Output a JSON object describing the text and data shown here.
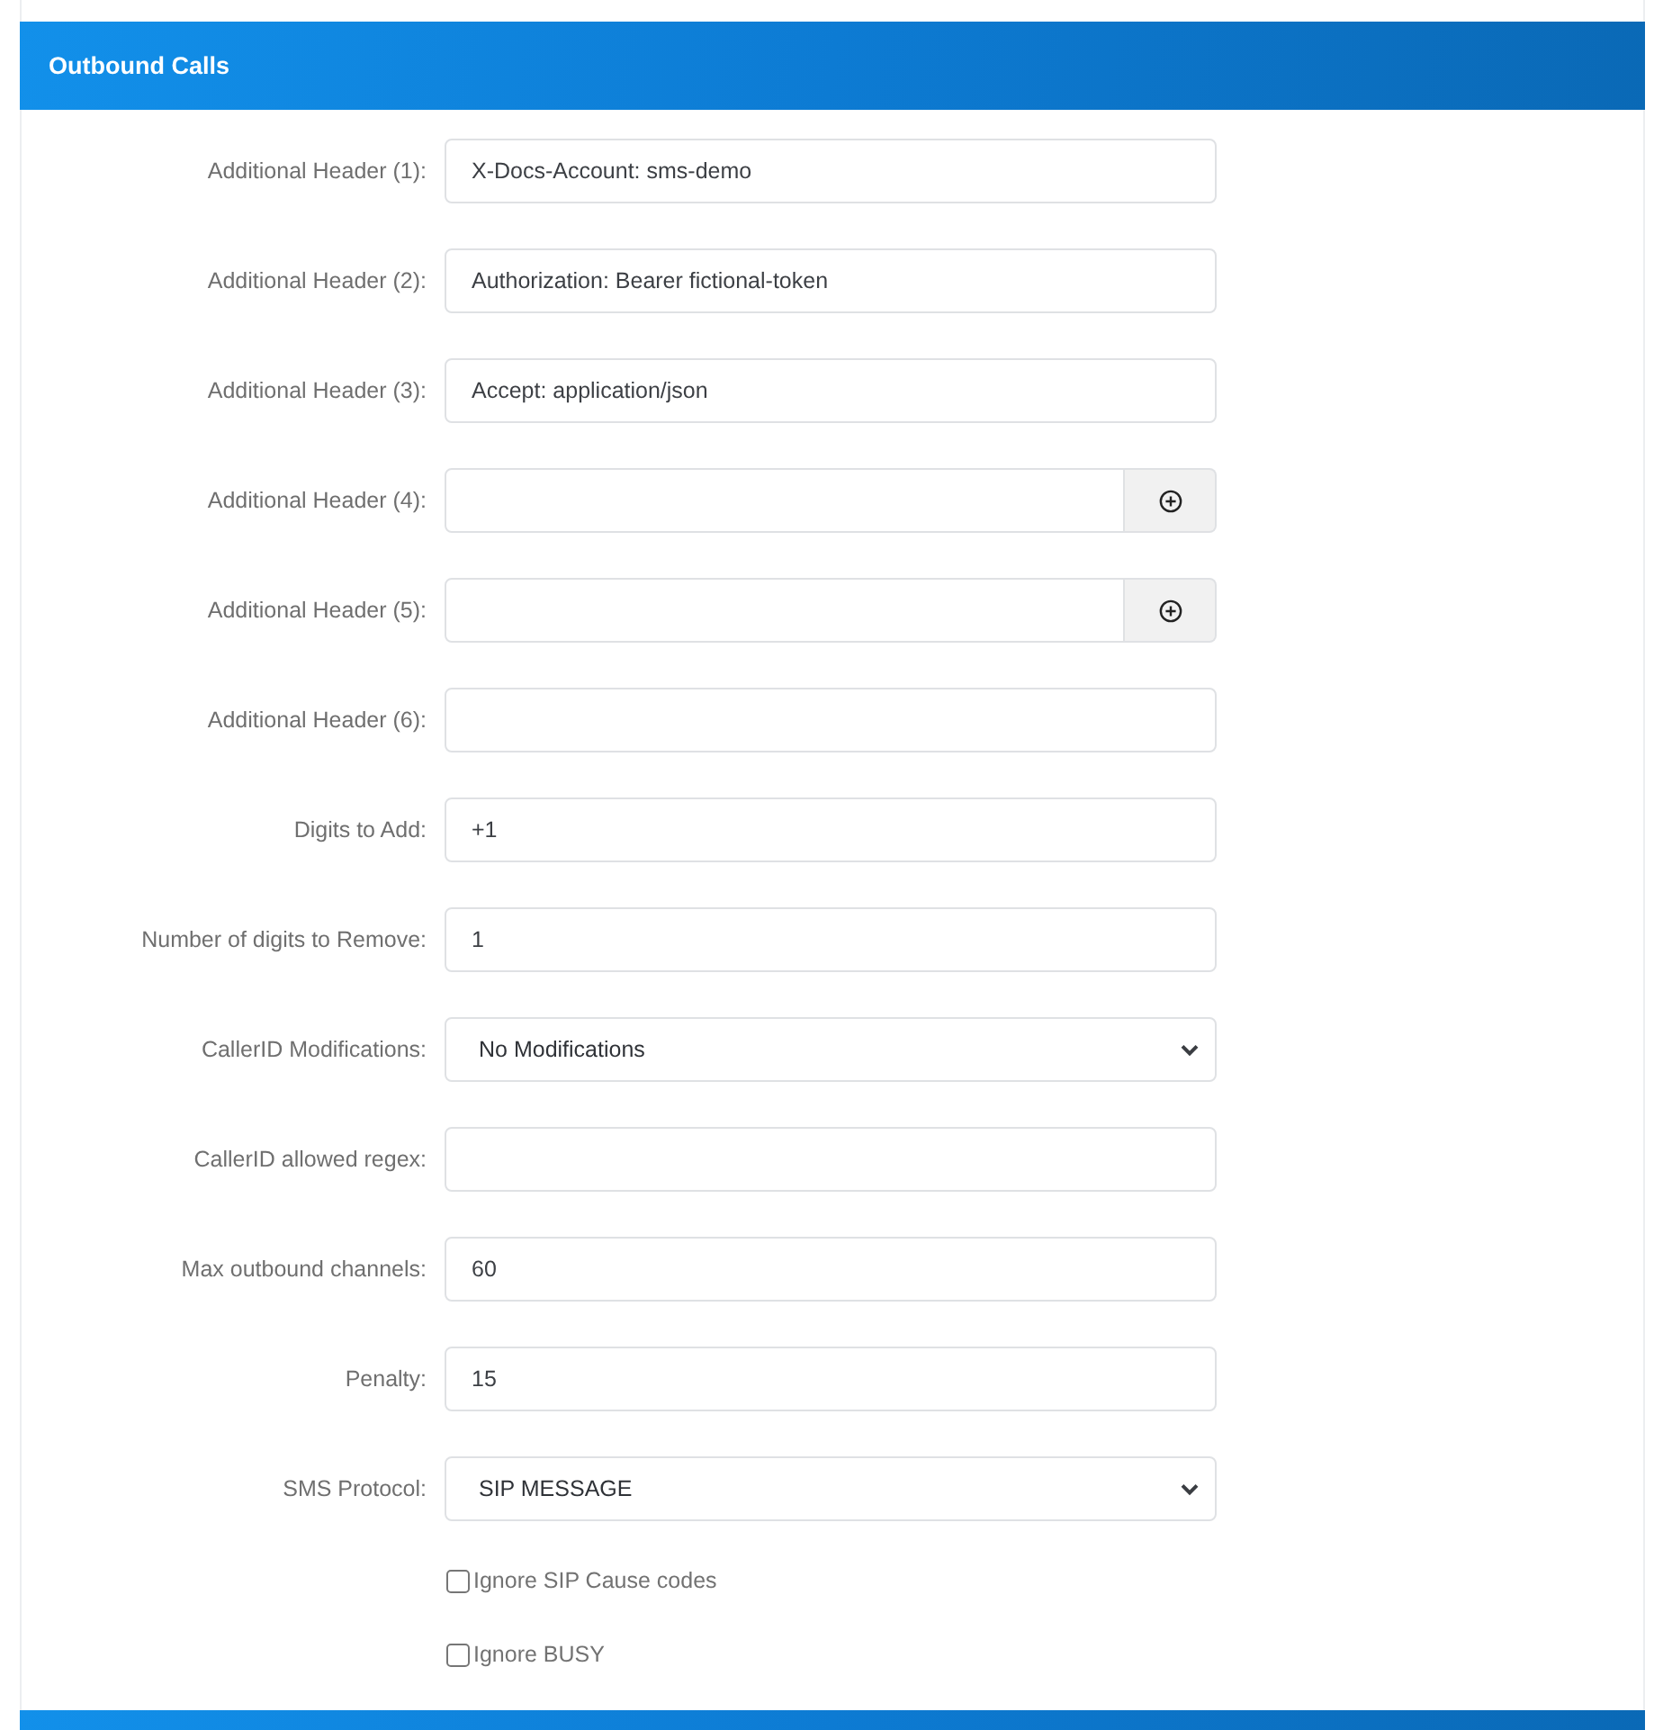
{
  "panel": {
    "title": "Outbound Calls"
  },
  "fields": [
    {
      "kind": "text",
      "label": "Additional Header (1):",
      "value": "X-Docs-Account: sms-demo"
    },
    {
      "kind": "text",
      "label": "Additional Header (2):",
      "value": "Authorization: Bearer fictional-token"
    },
    {
      "kind": "text",
      "label": "Additional Header (3):",
      "value": "Accept: application/json"
    },
    {
      "kind": "text_add",
      "label": "Additional Header (4):"
    },
    {
      "kind": "text_add",
      "label": "Additional Header (5):"
    },
    {
      "kind": "text",
      "label": "Additional Header (6):"
    },
    {
      "kind": "text",
      "label": "Digits to Add:",
      "value": "+1"
    },
    {
      "kind": "text",
      "label": "Number of digits to Remove:",
      "value": "1"
    },
    {
      "kind": "select",
      "label": "CallerID Modifications:",
      "value": "No Modifications"
    },
    {
      "kind": "text",
      "label": "CallerID allowed regex:"
    },
    {
      "kind": "text",
      "label": "Max outbound channels:",
      "value": "60"
    },
    {
      "kind": "text",
      "label": "Penalty:",
      "value": "15"
    },
    {
      "kind": "select",
      "label": "SMS Protocol:",
      "value": "SIP MESSAGE"
    }
  ],
  "checkboxes": [
    {
      "label": "Ignore SIP Cause codes",
      "checked": false
    },
    {
      "label": "Ignore BUSY",
      "checked": false
    }
  ]
}
